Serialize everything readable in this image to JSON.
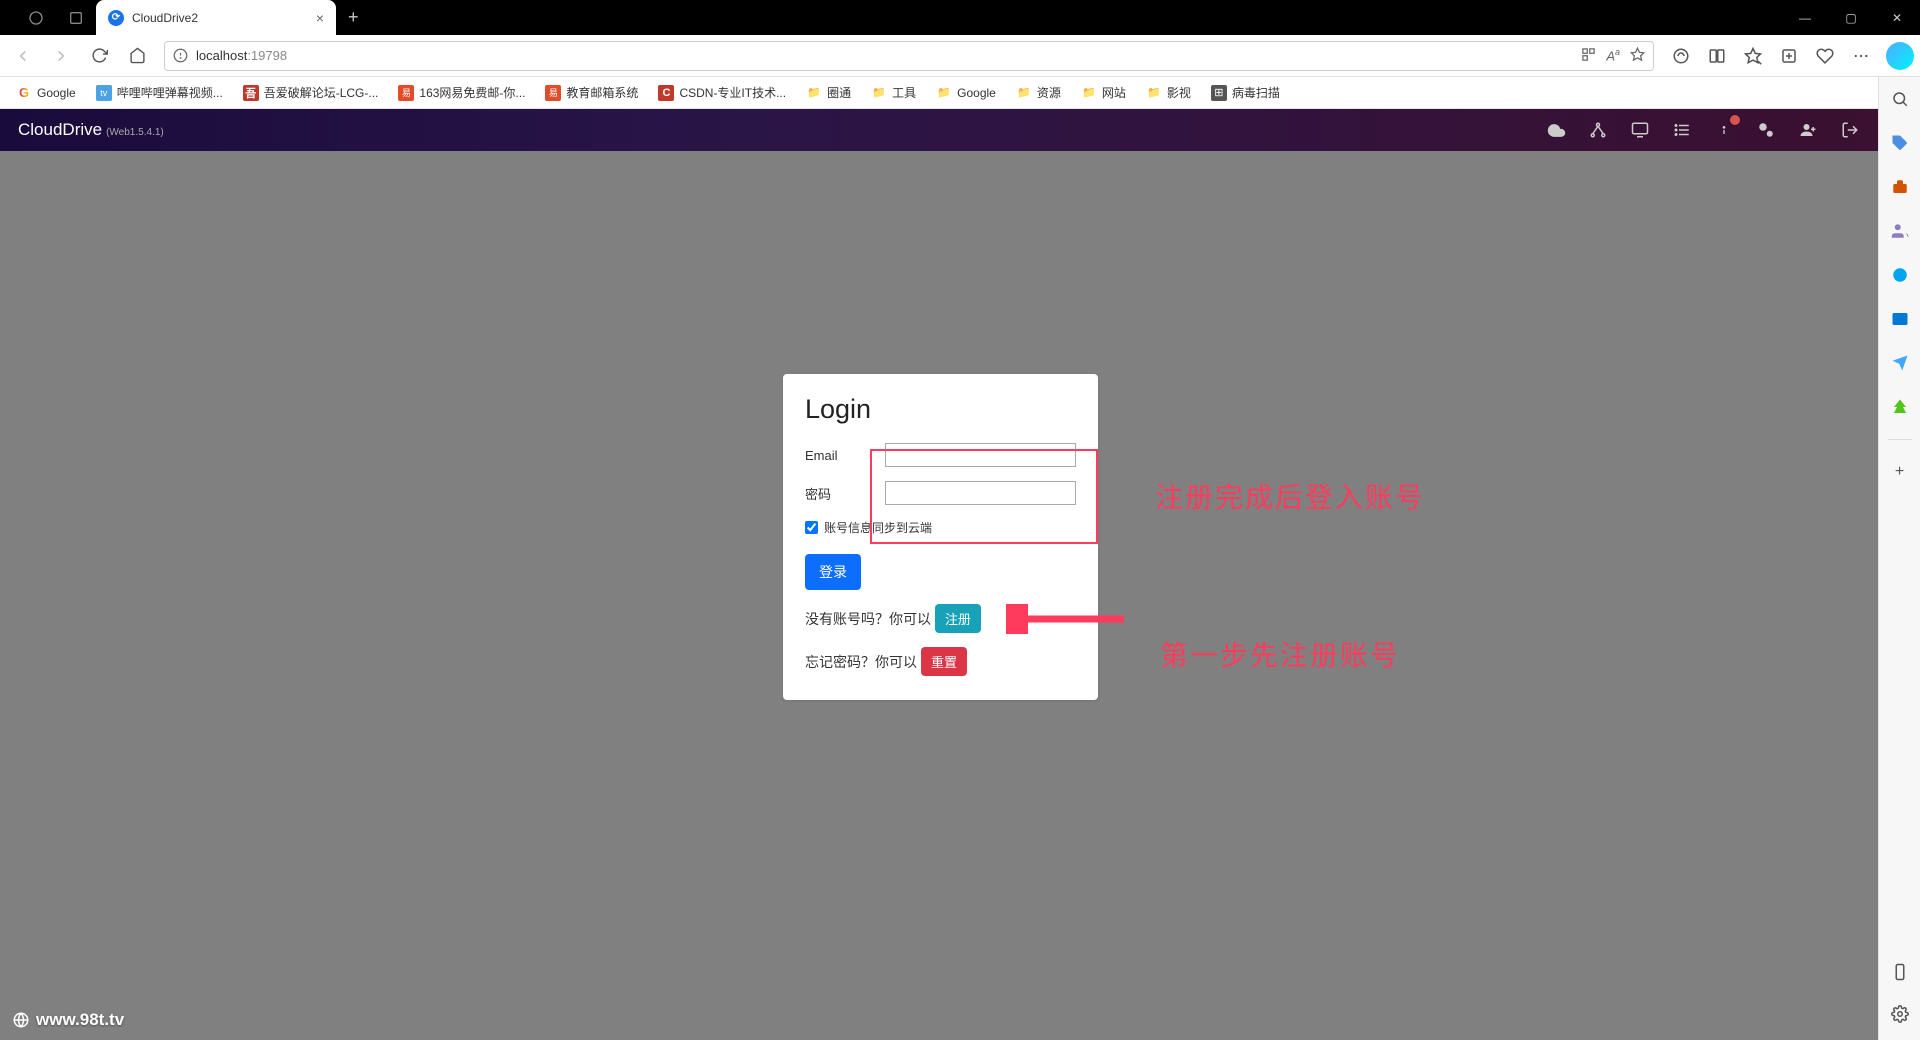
{
  "browser": {
    "tab_title": "CloudDrive2",
    "url_host": "localhost",
    "url_port": ":19798",
    "window_controls": {
      "min": "—",
      "max": "▢",
      "close": "✕"
    }
  },
  "bookmarks": [
    {
      "label": "Google",
      "icon": "g"
    },
    {
      "label": "哔哩哔哩弹幕视频...",
      "icon": "bili"
    },
    {
      "label": "吾爱破解论坛-LCG-...",
      "icon": "red"
    },
    {
      "label": "163网易免费邮-你...",
      "icon": "orange"
    },
    {
      "label": "教育邮箱系统",
      "icon": "orange"
    },
    {
      "label": "CSDN-专业IT技术...",
      "icon": "csdn"
    },
    {
      "label": "圈通",
      "icon": "folder"
    },
    {
      "label": "工具",
      "icon": "folder"
    },
    {
      "label": "Google",
      "icon": "folder"
    },
    {
      "label": "资源",
      "icon": "folder"
    },
    {
      "label": "网站",
      "icon": "folder"
    },
    {
      "label": "影视",
      "icon": "folder"
    },
    {
      "label": "病毒扫描",
      "icon": "grey"
    }
  ],
  "app": {
    "brand": "CloudDrive",
    "version": "(Web1.5.4.1)"
  },
  "login": {
    "title": "Login",
    "email_label": "Email",
    "password_label": "密码",
    "sync_label": "账号信息同步到云端",
    "login_btn": "登录",
    "no_account_text": "没有账号吗？你可以",
    "register_btn": "注册",
    "forgot_text": "忘记密码？你可以",
    "reset_btn": "重置"
  },
  "annotations": {
    "text1": "注册完成后登入账号",
    "text2": "第一步先注册账号"
  },
  "watermark": "www.98t.tv"
}
